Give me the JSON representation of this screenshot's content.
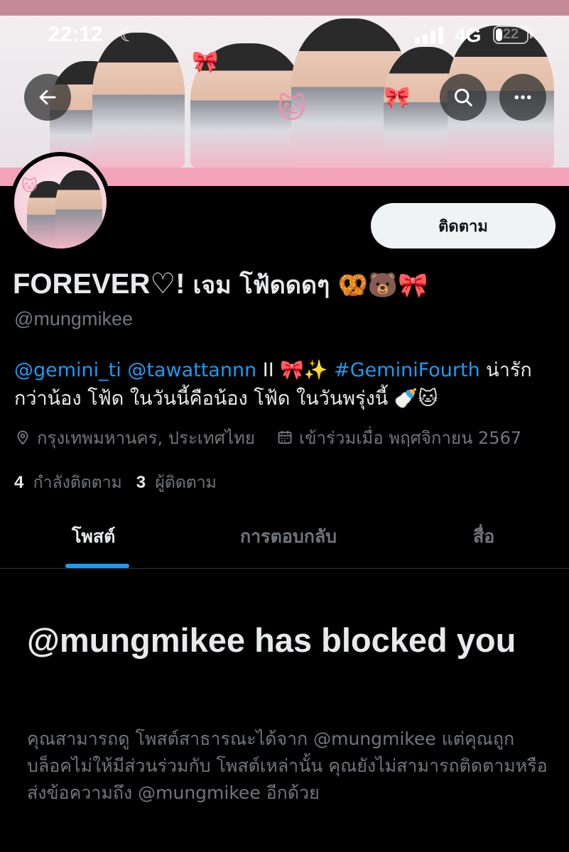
{
  "status_bar": {
    "time": "22:12",
    "network": "4G",
    "battery": "22",
    "battery_percent": 22
  },
  "header": {
    "back_icon": "arrow-left-icon",
    "search_icon": "search-icon",
    "more_icon": "more-horizontal-icon"
  },
  "profile": {
    "follow_label": "ติดตาม",
    "display_name_latin": "FOREVER♡!",
    "display_name_thai": "เจม โฟ้ดดดๆ",
    "display_name_emoji": "🥨🐻🎀",
    "handle": "@mungmikee",
    "bio": {
      "mention_1": "@gemini_ti",
      "mention_2": "@tawattannn",
      "separator": "II 🎀✨",
      "hashtag": "#GeminiFourth",
      "text": "น่ารักกว่าน้อง โฟ้ด ในวันนี้คือน้อง โฟ้ด  ในวันพรุ่งนี้ 🍼🐱"
    },
    "location": "กรุงเทพมหานคร, ประเทศไทย",
    "joined": "เข้าร่วมเมื่อ พฤศจิกายน 2567",
    "following_count": "4",
    "following_label": "กำลังติดตาม",
    "followers_count": "3",
    "followers_label": "ผู้ติดตาม"
  },
  "tabs": [
    {
      "label": "โพสต์",
      "active": true
    },
    {
      "label": "การตอบกลับ",
      "active": false
    },
    {
      "label": "สื่อ",
      "active": false
    }
  ],
  "blocked": {
    "title": "@mungmikee has blocked you",
    "body": "คุณสามารถดู โพสต์สาธารณะได้จาก @mungmikee แต่คุณถูกบล็อคไม่ให้มีส่วนร่วมกับ โพสต์เหล่านั้น คุณยังไม่สามารถติดตามหรือส่งข้อความถึง @mungmikee อีกด้วย"
  },
  "colors": {
    "background": "#000000",
    "accent": "#1d9bf0",
    "text_primary": "#e7e9ea",
    "text_secondary": "#71767b",
    "banner_pink": "#f2a3ba"
  }
}
